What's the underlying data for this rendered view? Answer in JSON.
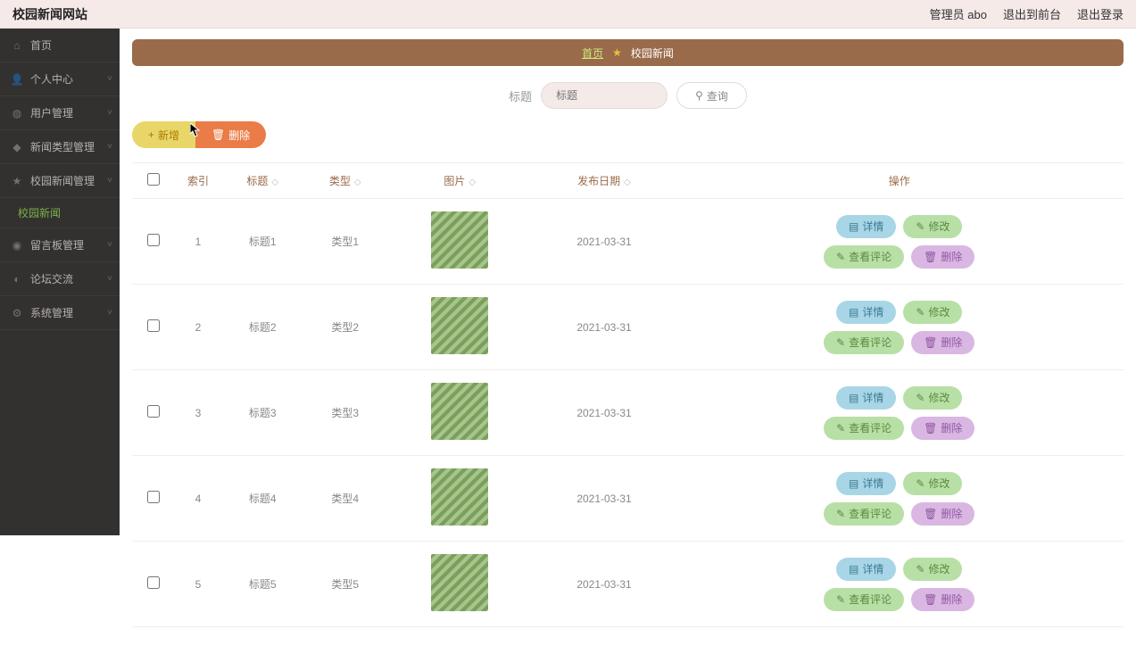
{
  "header": {
    "title": "校园新闻网站",
    "admin": "管理员 abo",
    "front": "退出到前台",
    "logout": "退出登录"
  },
  "sidebar": {
    "items": [
      {
        "label": "首页",
        "icon": "home"
      },
      {
        "label": "个人中心",
        "icon": "user"
      },
      {
        "label": "用户管理",
        "icon": "users"
      },
      {
        "label": "新闻类型管理",
        "icon": "type"
      },
      {
        "label": "校园新闻管理",
        "icon": "news"
      },
      {
        "label": "留言板管理",
        "icon": "msg"
      },
      {
        "label": "论坛交流",
        "icon": "forum"
      },
      {
        "label": "系统管理",
        "icon": "sys"
      }
    ],
    "sub": {
      "label": "校园新闻"
    }
  },
  "breadcrumb": {
    "home": "首页",
    "current": "校园新闻"
  },
  "filter": {
    "label": "标题",
    "placeholder": "标题",
    "query": "查询"
  },
  "actions": {
    "add": "新增",
    "del": "删除"
  },
  "table": {
    "cols": {
      "index": "索引",
      "title": "标题",
      "type": "类型",
      "image": "图片",
      "date": "发布日期",
      "ops": "操作"
    },
    "ops": {
      "detail": "详情",
      "edit": "修改",
      "view": "查看评论",
      "del": "删除"
    },
    "rows": [
      {
        "idx": "1",
        "title": "标题1",
        "type": "类型1",
        "date": "2021-03-31"
      },
      {
        "idx": "2",
        "title": "标题2",
        "type": "类型2",
        "date": "2021-03-31"
      },
      {
        "idx": "3",
        "title": "标题3",
        "type": "类型3",
        "date": "2021-03-31"
      },
      {
        "idx": "4",
        "title": "标题4",
        "type": "类型4",
        "date": "2021-03-31"
      },
      {
        "idx": "5",
        "title": "标题5",
        "type": "类型5",
        "date": "2021-03-31"
      }
    ]
  }
}
